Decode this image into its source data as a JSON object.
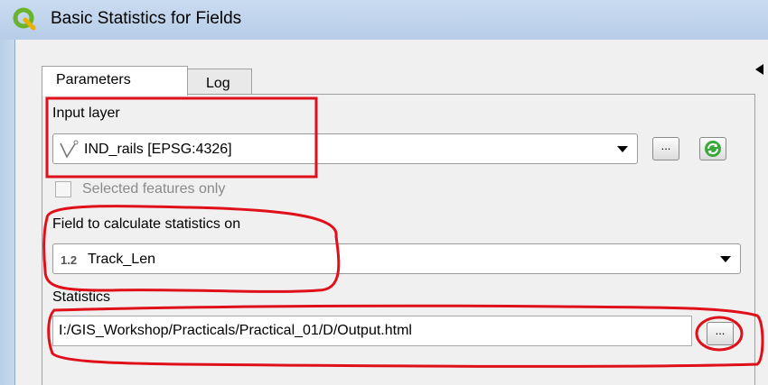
{
  "window": {
    "title": "Basic Statistics for Fields",
    "icon": "qgis-logo-icon"
  },
  "tabs": [
    {
      "label": "Parameters",
      "active": true
    },
    {
      "label": "Log",
      "active": false
    }
  ],
  "input_layer": {
    "label": "Input layer",
    "layer_icon": "line-layer-icon",
    "value": "IND_rails [EPSG:4326]",
    "browse_label": "...",
    "iterate_icon": "green-refresh-icon"
  },
  "selected_only": {
    "label": "Selected features only",
    "checked": false
  },
  "field": {
    "label": "Field to calculate statistics on",
    "type_badge": "1.2",
    "value": "Track_Len"
  },
  "statistics": {
    "label": "Statistics",
    "value": "I:/GIS_Workshop/Practicals/Practical_01/D/Output.html",
    "browse_label": "..."
  },
  "colors": {
    "highlight": "#e0101a",
    "titlebar": "#bcd2ec",
    "refresh_green": "#2e9a2e"
  }
}
